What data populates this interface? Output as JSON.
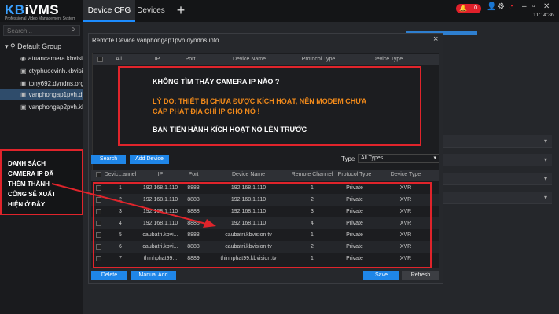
{
  "app": {
    "logo_prefix": "KB",
    "logo_main": "iVMS",
    "logo_sub": "Professional Video Management System"
  },
  "tabs": [
    {
      "label": "Device CFG"
    },
    {
      "label": "Devices"
    }
  ],
  "topbar": {
    "alarm_count": "0",
    "clock": "11:14:36"
  },
  "search": {
    "placeholder": "Search..."
  },
  "tree": {
    "root": "Default Group",
    "items": [
      {
        "label": "atuancamera.kbvision"
      },
      {
        "label": "ctyphuocvinh.kbvision"
      },
      {
        "label": "tony692.dyndns.org"
      },
      {
        "label": "vanphongap1pvh.dy"
      },
      {
        "label": "vanphongap2pvh.kb"
      }
    ]
  },
  "dialog": {
    "title": "Remote Device vanphongap1pvh.dyndns.info",
    "upper_headers": [
      "All",
      "IP",
      "Port",
      "Device Name",
      "Protocol Type",
      "Device Type"
    ],
    "search_btn": "Search",
    "add_device_btn": "Add Device",
    "type_label": "Type",
    "type_value": "All Types",
    "lower_headers": [
      "Devic...annel",
      "IP",
      "Port",
      "Device Name",
      "Remote Channel",
      "Protocol Type",
      "Device Type"
    ],
    "rows": [
      [
        "1",
        "192.168.1.110",
        "8888",
        "192.168.1.110",
        "1",
        "Private",
        "XVR"
      ],
      [
        "2",
        "192.168.1.110",
        "8888",
        "192.168.1.110",
        "2",
        "Private",
        "XVR"
      ],
      [
        "3",
        "192.168.1.110",
        "8888",
        "192.168.1.110",
        "3",
        "Private",
        "XVR"
      ],
      [
        "4",
        "192.168.1.110",
        "8888",
        "192.168.1.110",
        "4",
        "Private",
        "XVR"
      ],
      [
        "5",
        "caubatri.kbvi...",
        "8888",
        "caubatri.kbvision.tv",
        "1",
        "Private",
        "XVR"
      ],
      [
        "6",
        "caubatri.kbvi...",
        "8888",
        "caubatri.kbvision.tv",
        "2",
        "Private",
        "XVR"
      ],
      [
        "7",
        "thinhphat99...",
        "8889",
        "thinhphat99.kbvision.tv",
        "1",
        "Private",
        "XVR"
      ]
    ],
    "delete_btn": "Delete",
    "manual_add_btn": "Manual Add",
    "save_btn": "Save",
    "refresh_btn": "Refresh"
  },
  "notice": {
    "line1": "KHÔNG TÌM THẤY CAMERA IP NÀO ?",
    "line2": "LÝ DO: THIẾT BỊ CHƯA ĐƯỢC KÍCH HOẠT, NÊN MODEM CHƯA",
    "line3": "CẤP PHÁT ĐỊA CHỈ IP CHO NÓ !",
    "line4": "BẠN TIẾN HÀNH KÍCH HOẠT NÓ LÊN TRƯỚC"
  },
  "side_note": {
    "lines": [
      "DANH SÁCH",
      "CAMERA IP ĐÃ",
      "THÊM THÀNH",
      "CÔNG SẼ XUẤT",
      "HIỆN Ở ĐÂY"
    ]
  },
  "colors": {
    "accent": "#1f86e8",
    "annotation_red": "#e0242b",
    "annotation_orange": "#f28a1a",
    "alarm_red": "#e0202a"
  }
}
